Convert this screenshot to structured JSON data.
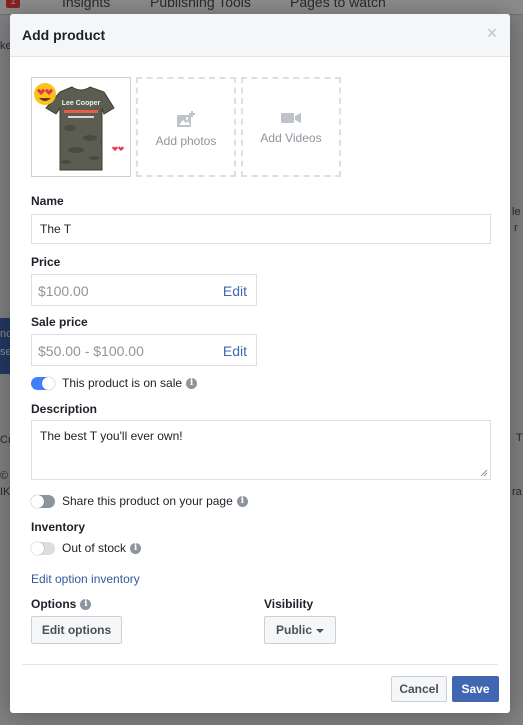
{
  "background": {
    "tabs": [
      "Insights",
      "Publishing Tools",
      "Pages to watch"
    ],
    "badge": "1",
    "fragments": [
      "ke",
      "le",
      "r",
      "nc",
      "se",
      "Cr",
      "©",
      "IK",
      "ra",
      "T"
    ]
  },
  "modal": {
    "title": "Add product",
    "close_label": "×"
  },
  "media": {
    "add_photos": "Add photos",
    "add_videos": "Add Videos",
    "thumbnail_brand": "Lee Cooper"
  },
  "form": {
    "name_label": "Name",
    "name_value": "The T",
    "price_label": "Price",
    "price_value": "$100.00",
    "price_edit": "Edit",
    "sale_price_label": "Sale price",
    "sale_price_value": "$50.00 - $100.00",
    "sale_price_edit": "Edit",
    "on_sale_label": "This product is on sale",
    "on_sale_enabled": true,
    "description_label": "Description",
    "description_value": "The best  T you'll ever own!",
    "share_label": "Share this product on your page",
    "share_enabled": false,
    "inventory_label": "Inventory",
    "out_of_stock_label": "Out of stock",
    "out_of_stock_enabled": false,
    "edit_inventory_link": "Edit option inventory",
    "options_label": "Options",
    "edit_options_button": "Edit options",
    "visibility_label": "Visibility",
    "visibility_value": "Public"
  },
  "footer": {
    "cancel": "Cancel",
    "save": "Save"
  },
  "colors": {
    "accent": "#4267b2",
    "toggle_on": "#4080ff",
    "link": "#365899"
  }
}
